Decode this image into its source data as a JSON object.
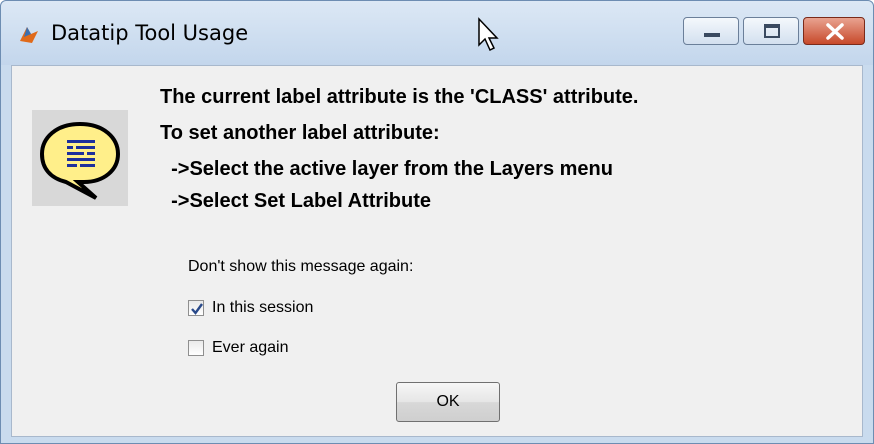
{
  "window": {
    "title": "Datatip Tool Usage",
    "icon": "matlab-icon"
  },
  "title_controls": {
    "minimize_icon": "minimize-icon",
    "maximize_icon": "maximize-icon",
    "close_icon": "close-icon"
  },
  "message": {
    "icon": "speech-bubble-info-icon",
    "lines": [
      "The current label attribute is the 'CLASS' attribute.",
      "To set another label attribute:",
      "  ->Select the active layer from the Layers menu",
      "  ->Select Set Label Attribute"
    ]
  },
  "options": {
    "prompt": "Don't show this message again:",
    "in_session": {
      "label": "In this session",
      "checked": true
    },
    "ever_again": {
      "label": "Ever again",
      "checked": false
    }
  },
  "buttons": {
    "ok_label": "OK"
  },
  "colors": {
    "title_bar": "#c3d6ec",
    "client_bg": "#f0f0f0",
    "close_button": "#c7492a",
    "check_mark": "#2a4a8a"
  }
}
